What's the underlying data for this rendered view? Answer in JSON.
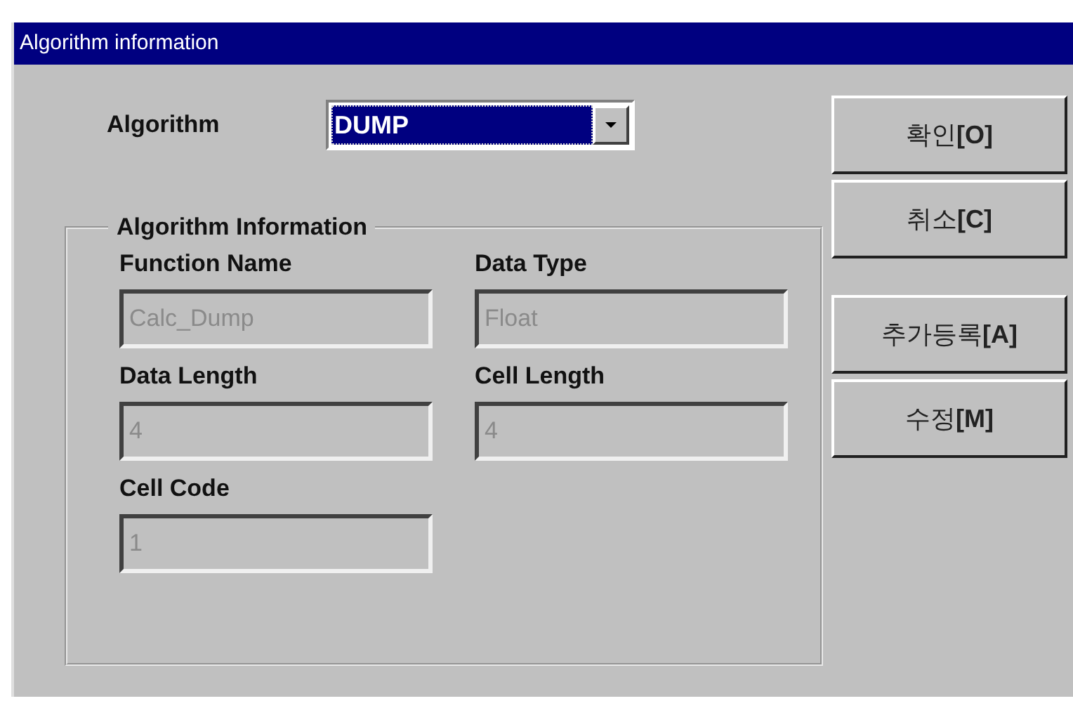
{
  "window": {
    "title": "Algorithm information"
  },
  "algorithm": {
    "label": "Algorithm",
    "value": "DUMP"
  },
  "group": {
    "title": "Algorithm Information",
    "fields": [
      {
        "label": "Function Name",
        "value": "Calc_Dump",
        "disabled": true
      },
      {
        "label": "Data Type",
        "value": "Float",
        "disabled": true
      },
      {
        "label": "Data Length",
        "value": "4",
        "disabled": true
      },
      {
        "label": "Cell Length",
        "value": "4",
        "disabled": true
      },
      {
        "label": "Cell Code",
        "value": "1",
        "disabled": true
      }
    ]
  },
  "buttons": [
    {
      "label": "확인**[O]**"
    },
    {
      "label": "취소**[C]**"
    },
    {
      "label": "추가등록**[A]**"
    },
    {
      "label": "수정**[M]**"
    }
  ]
}
